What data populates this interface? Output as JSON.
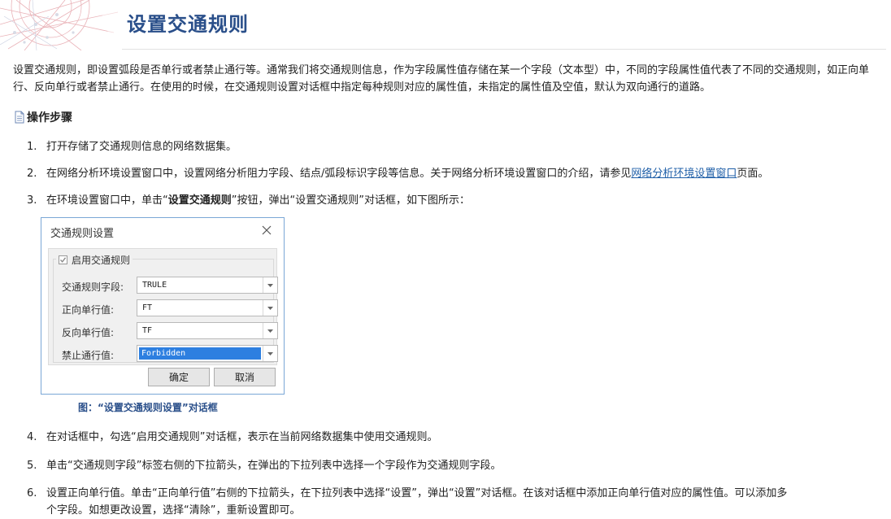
{
  "page": {
    "title": "设置交通规则",
    "intro": "设置交通规则，即设置弧段是否单行或者禁止通行等。通常我们将交通规则信息，作为字段属性值存储在某一个字段（文本型）中，不同的字段属性值代表了不同的交通规则，如正向单行、反向单行或者禁止通行。在使用的时候，在交通规则设置对话框中指定每种规则对应的属性值，未指定的属性值及空值，默认为双向通行的道路。",
    "steps_heading": "操作步骤"
  },
  "steps": {
    "s1": {
      "num": "1.",
      "text": "打开存储了交通规则信息的网络数据集。"
    },
    "s2": {
      "num": "2.",
      "text_a": "在网络分析环境设置窗口中，设置网络分析阻力字段、结点/弧段标识字段等信息。关于网络分析环境设置窗口的介绍，请参见",
      "link": "网络分析环境设置窗口",
      "text_b": "页面。"
    },
    "s3": {
      "num": "3.",
      "text_a": "在环境设置窗口中，单击“",
      "bold": "设置交通规则",
      "text_b": "”按钮，弹出“设置交通规则”对话框，如下图所示："
    },
    "s4": {
      "num": "4.",
      "text": "在对话框中，勾选“启用交通规则”对话框，表示在当前网络数据集中使用交通规则。"
    },
    "s5": {
      "num": "5.",
      "text": "单击“交通规则字段”标签右侧的下拉箭头，在弹出的下拉列表中选择一个字段作为交通规则字段。"
    },
    "s6": {
      "num": "6.",
      "line1": "设置正向单行值。单击“正向单行值”右侧的下拉箭头，在下拉列表中选择“设置”，弹出“设置”对话框。在该对话框中添加正向单行值对应的属性值。可以添加多",
      "line2": "个字段。如想更改设置，选择“清除”，重新设置即可。"
    }
  },
  "dialog": {
    "title": "交通规则设置",
    "enable_label": "启用交通规则",
    "enable_checked": true,
    "rule_field_label": "交通规则字段:",
    "rule_field_value": "TRULE",
    "forward_label": "正向单行值:",
    "forward_value": "FT",
    "reverse_label": "反向单行值:",
    "reverse_value": "TF",
    "forbidden_label": "禁止通行值:",
    "forbidden_value": "Forbidden",
    "ok_label": "确定",
    "cancel_label": "取消"
  },
  "figure_caption": "图：“设置交通规则设置”对话框",
  "colors": {
    "title": "#2a4f8a",
    "link": "#1f5fa8",
    "selection": "#2d7fe0",
    "dialog_border": "#7aa7d6"
  }
}
